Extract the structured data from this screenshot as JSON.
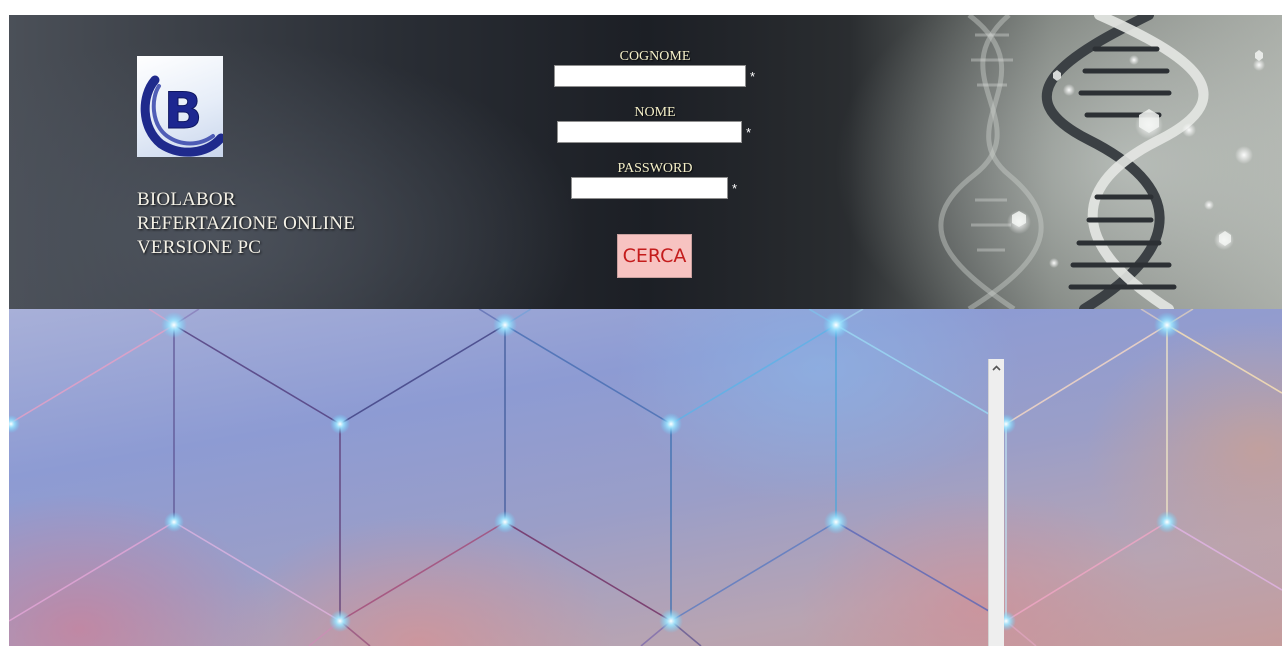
{
  "brand": {
    "logo_letter": "B",
    "lines": [
      "BIOLABOR",
      "REFERTAZIONE ONLINE",
      "VERSIONE PC"
    ]
  },
  "form": {
    "cognome": {
      "label": "COGNOME",
      "value": "",
      "required_mark": "*"
    },
    "nome": {
      "label": "NOME",
      "value": "",
      "required_mark": "*"
    },
    "password": {
      "label": "PASSWORD",
      "value": "",
      "required_mark": "*"
    },
    "submit_label": "CERCA"
  },
  "icons": {
    "logo": "biolabor-logo",
    "scroll_up": "chevron-up-icon"
  },
  "colors": {
    "header_dark": "#1c1f25",
    "label_text": "#f4efc8",
    "button_bg": "#f7c3c1",
    "button_text": "#c41c1c",
    "logo_blue": "#1f2a8c"
  }
}
